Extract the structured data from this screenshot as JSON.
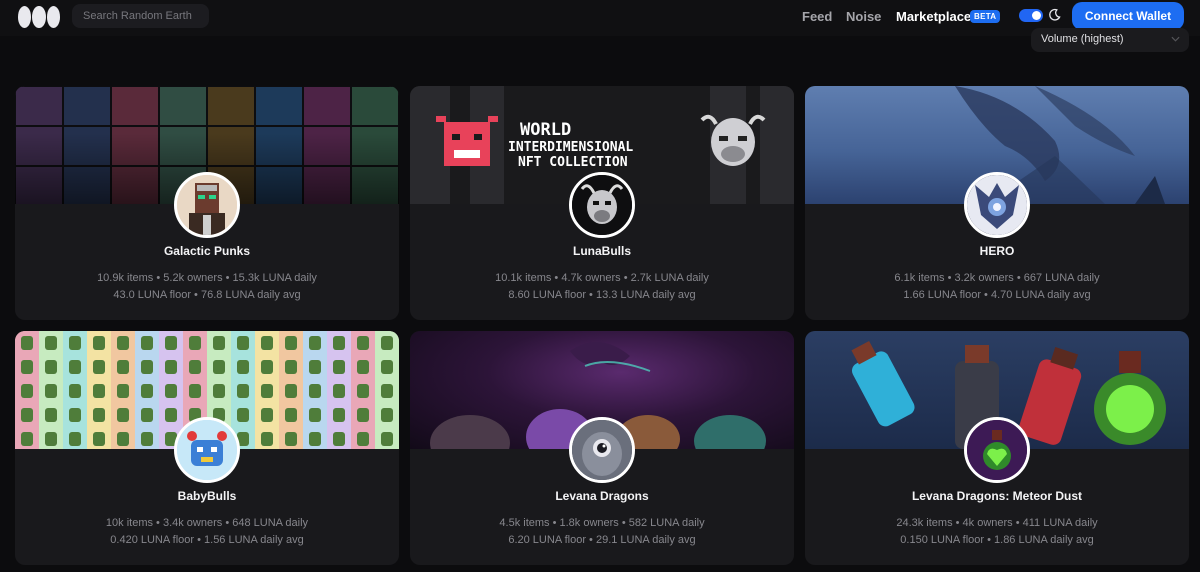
{
  "header": {
    "search_placeholder": "Search Random Earth",
    "nav": {
      "feed": "Feed",
      "noise": "Noise",
      "marketplace": "Marketplace",
      "beta": "BETA"
    },
    "connect_wallet": "Connect Wallet",
    "theme_toggle_on": true,
    "accent_color": "#1d6df2"
  },
  "sort": {
    "selected": "Volume (highest)"
  },
  "collections": [
    {
      "name": "Galactic Punks",
      "stats": "10.9k items • 5.2k owners • 15.3k LUNA daily",
      "floor": "43.0 LUNA floor • 76.8 LUNA daily avg"
    },
    {
      "name": "LunaBulls",
      "stats": "10.1k items • 4.7k owners • 2.7k LUNA daily",
      "floor": "8.60 LUNA floor • 13.3 LUNA daily avg",
      "banner_text_1": "WORLD",
      "banner_text_2": "INTERDIMENSIONAL",
      "banner_text_3": "NFT COLLECTION"
    },
    {
      "name": "HERO",
      "stats": "6.1k items • 3.2k owners • 667 LUNA daily",
      "floor": "1.66 LUNA floor • 4.70 LUNA daily avg"
    },
    {
      "name": "BabyBulls",
      "stats": "10k items • 3.4k owners • 648 LUNA daily",
      "floor": "0.420 LUNA floor • 1.56 LUNA daily avg"
    },
    {
      "name": "Levana Dragons",
      "stats": "4.5k items • 1.8k owners • 582 LUNA daily",
      "floor": "6.20 LUNA floor • 29.1 LUNA daily avg"
    },
    {
      "name": "Levana Dragons: Meteor Dust",
      "stats": "24.3k items • 4k owners • 411 LUNA daily",
      "floor": "0.150 LUNA floor • 1.86 LUNA daily avg"
    }
  ]
}
